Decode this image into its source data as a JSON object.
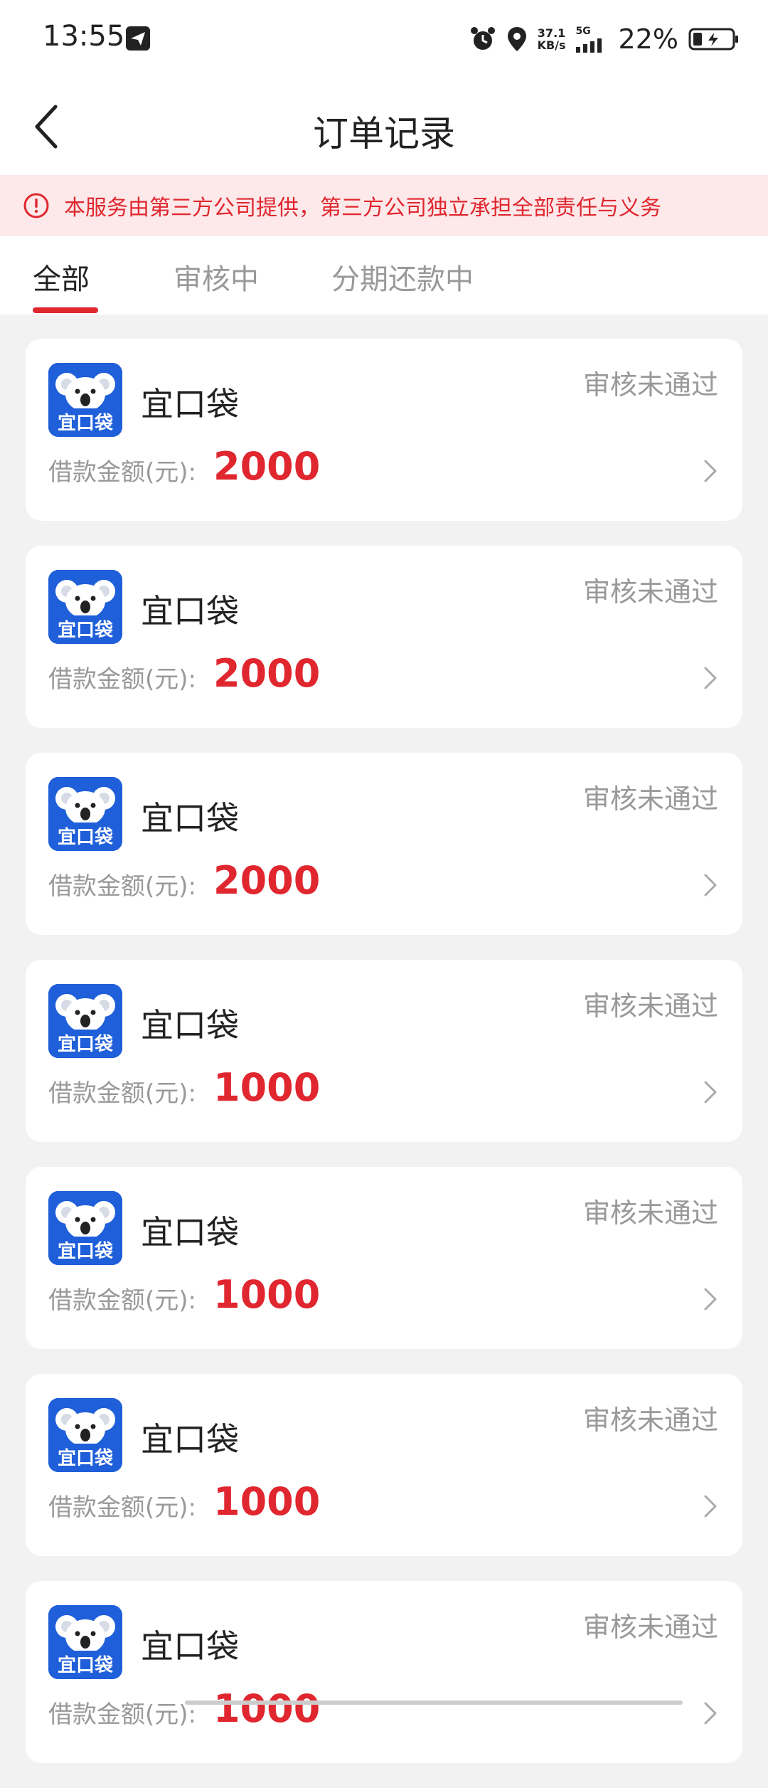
{
  "status_bar": {
    "time": "13:55",
    "net_speed_value": "37.1",
    "net_speed_unit": "KB/s",
    "network_type": "5G",
    "battery": "22%"
  },
  "header": {
    "title": "订单记录",
    "back_icon": "chevron-left-icon"
  },
  "notice": {
    "text": "本服务由第三方公司提供，第三方公司独立承担全部责任与义务",
    "icon": "alert-circle-icon"
  },
  "tabs": [
    {
      "label": "全部",
      "active": true
    },
    {
      "label": "审核中",
      "active": false
    },
    {
      "label": "分期还款中",
      "active": false
    }
  ],
  "orders": [
    {
      "app_name": "宜口袋",
      "status": "审核未通过",
      "amount_label": "借款金额(元):",
      "amount": "2000",
      "logo_text": "宜口袋"
    },
    {
      "app_name": "宜口袋",
      "status": "审核未通过",
      "amount_label": "借款金额(元):",
      "amount": "2000",
      "logo_text": "宜口袋"
    },
    {
      "app_name": "宜口袋",
      "status": "审核未通过",
      "amount_label": "借款金额(元):",
      "amount": "2000",
      "logo_text": "宜口袋"
    },
    {
      "app_name": "宜口袋",
      "status": "审核未通过",
      "amount_label": "借款金额(元):",
      "amount": "1000",
      "logo_text": "宜口袋"
    },
    {
      "app_name": "宜口袋",
      "status": "审核未通过",
      "amount_label": "借款金额(元):",
      "amount": "1000",
      "logo_text": "宜口袋"
    },
    {
      "app_name": "宜口袋",
      "status": "审核未通过",
      "amount_label": "借款金额(元):",
      "amount": "1000",
      "logo_text": "宜口袋"
    },
    {
      "app_name": "宜口袋",
      "status": "审核未通过",
      "amount_label": "借款金额(元):",
      "amount": "1000",
      "logo_text": "宜口袋"
    }
  ],
  "colors": {
    "accent_red": "#e0262e",
    "notice_bg": "#fde9ea",
    "logo_blue": "#1f5fd9",
    "muted_text": "#999999",
    "page_bg": "#f2f2f2"
  }
}
